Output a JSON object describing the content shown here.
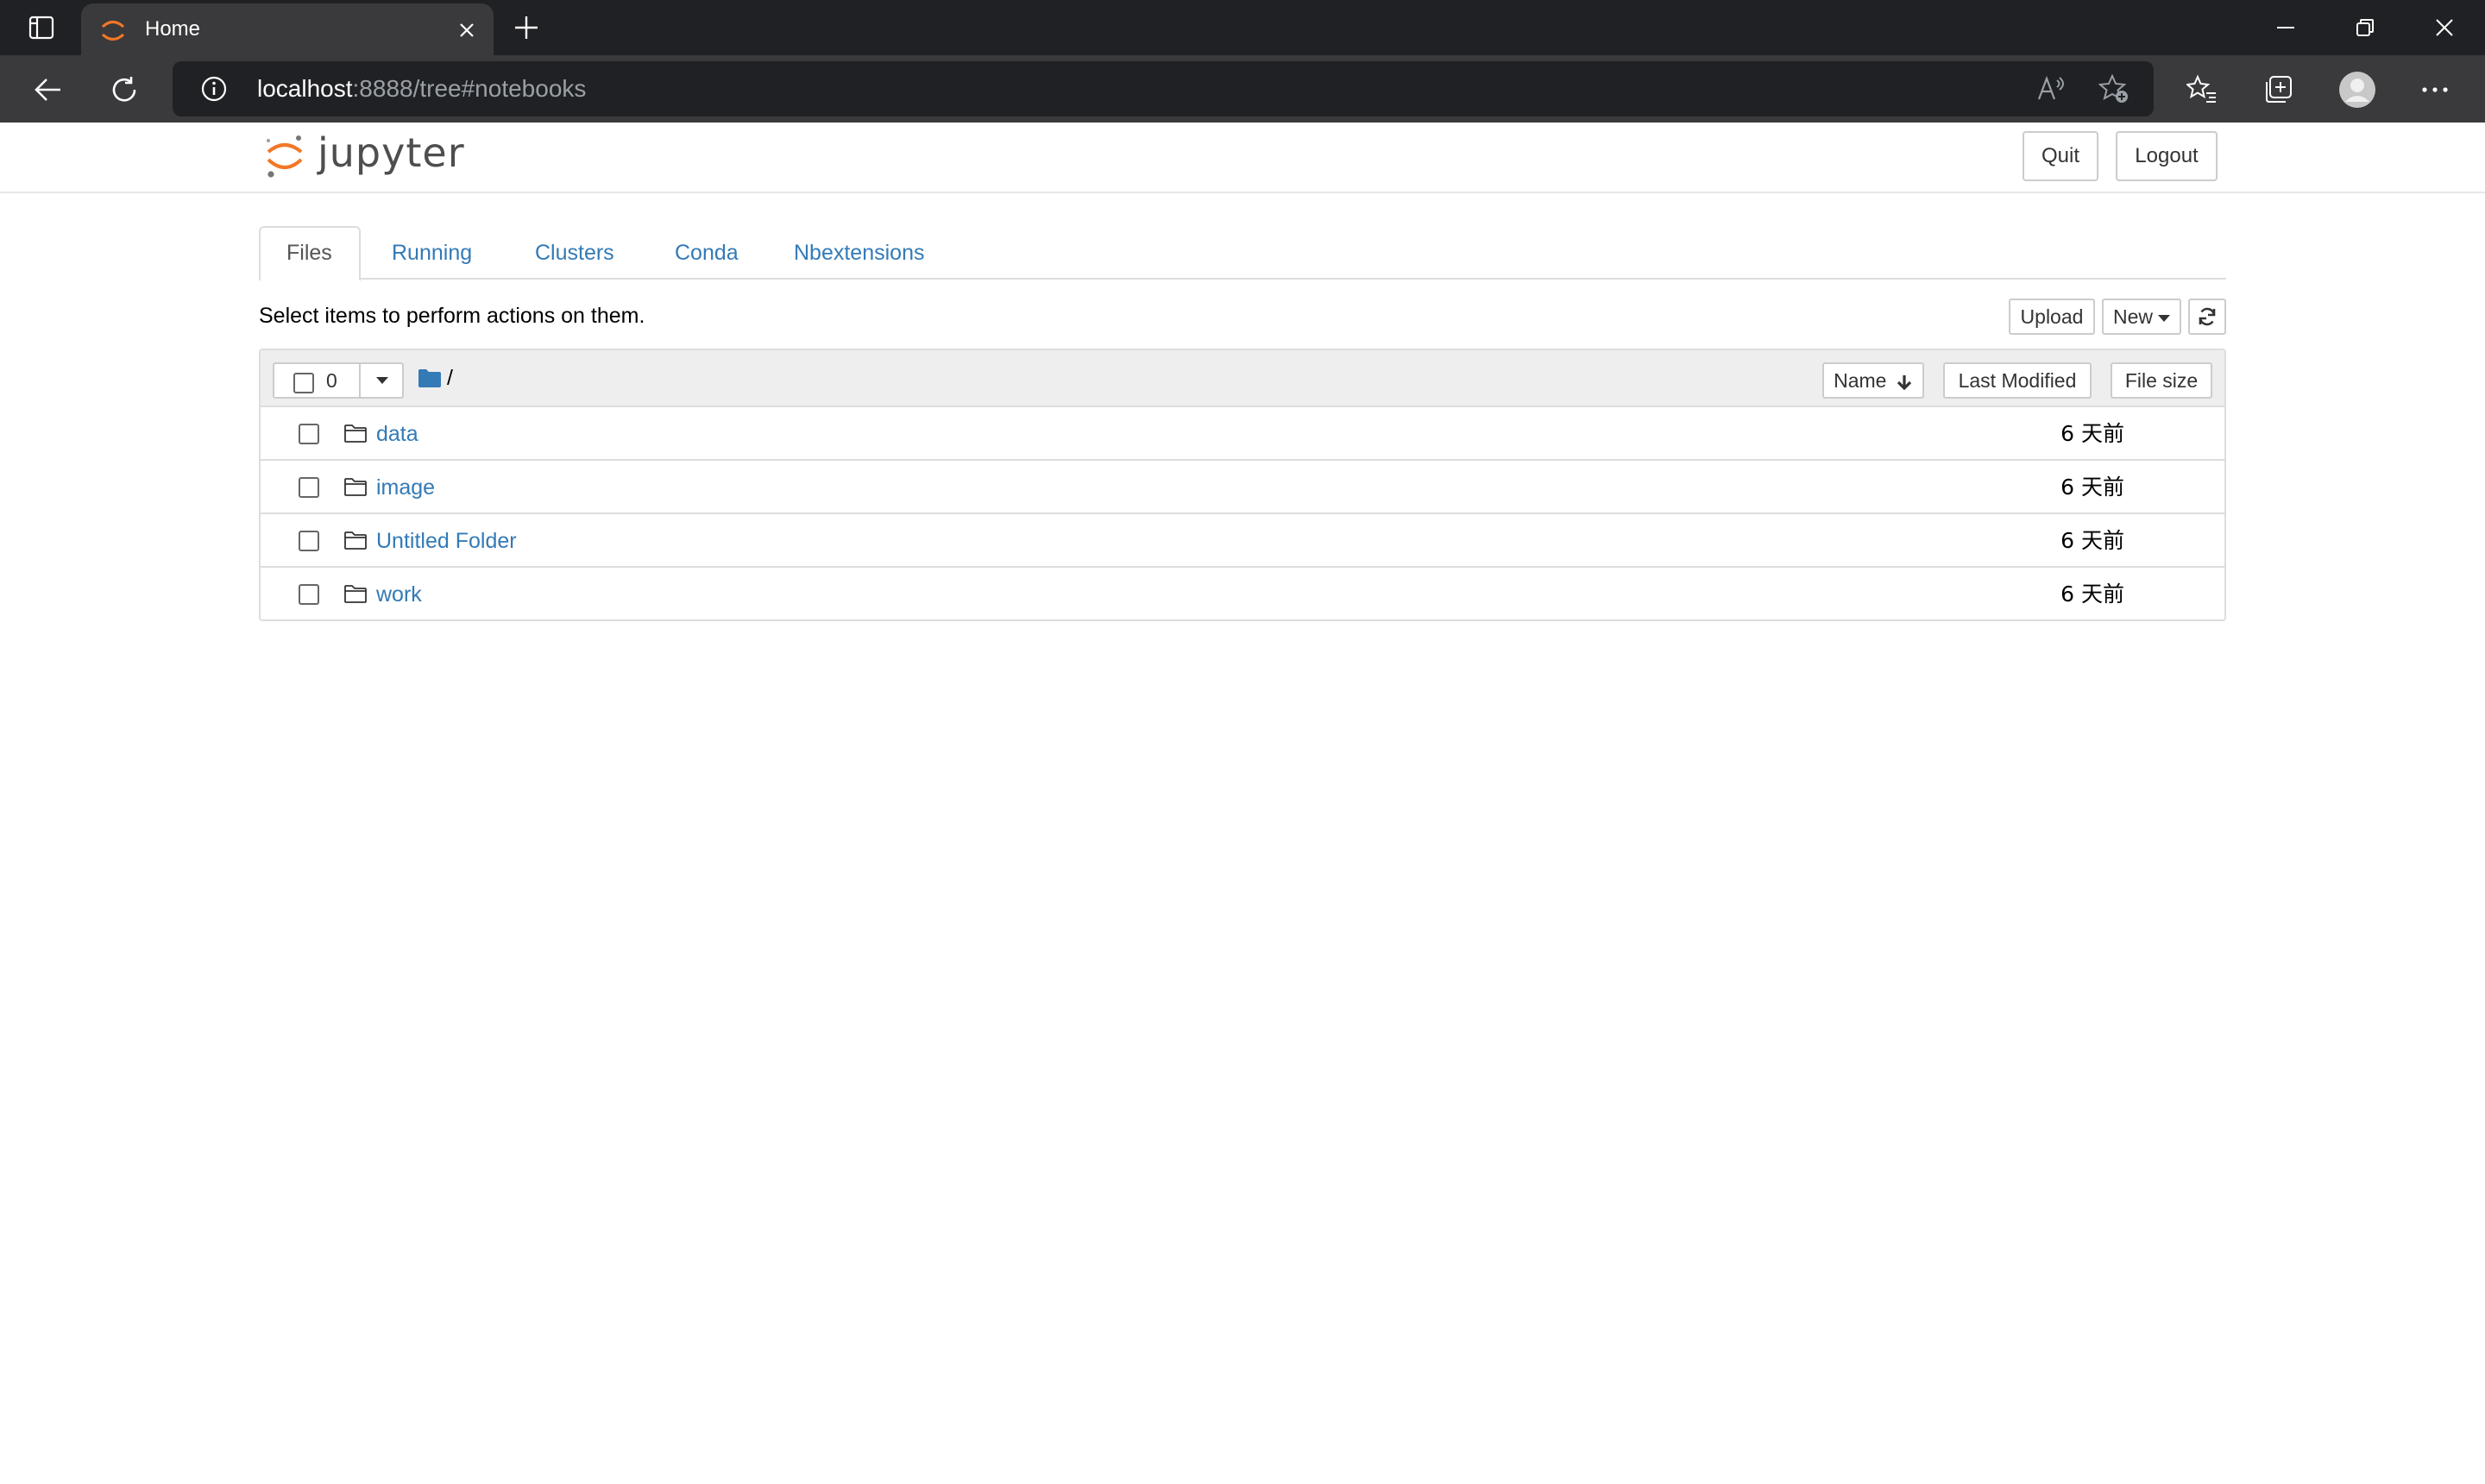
{
  "browser": {
    "tab_title": "Home",
    "url_host": "localhost",
    "url_rest": ":8888/tree#notebooks",
    "icons": {
      "tab_actions": "tab-actions-icon",
      "favicon": "jupyter-favicon",
      "close": "close-icon",
      "new_tab": "plus-icon",
      "back": "back-arrow-icon",
      "reload": "reload-icon",
      "info": "info-icon",
      "read_aloud": "read-aloud-icon",
      "add_favorite": "star-plus-icon",
      "favorites": "favorites-icon",
      "collections": "collections-icon",
      "profile": "profile-icon",
      "more": "more-icon"
    }
  },
  "header": {
    "logo_text": "jupyter",
    "quit_label": "Quit",
    "logout_label": "Logout"
  },
  "tabs": [
    {
      "label": "Files",
      "active": true
    },
    {
      "label": "Running",
      "active": false
    },
    {
      "label": "Clusters",
      "active": false
    },
    {
      "label": "Conda",
      "active": false
    },
    {
      "label": "Nbextensions",
      "active": false
    }
  ],
  "toolbar": {
    "hint": "Select items to perform actions on them.",
    "upload_label": "Upload",
    "new_label": "New"
  },
  "list": {
    "selected_count": "0",
    "breadcrumb_sep": "/",
    "sort_name_label": "Name",
    "sort_modified_label": "Last Modified",
    "sort_size_label": "File size",
    "items": [
      {
        "name": "data",
        "modified": "6 天前"
      },
      {
        "name": "image",
        "modified": "6 天前"
      },
      {
        "name": "Untitled Folder",
        "modified": "6 天前"
      },
      {
        "name": "work",
        "modified": "6 天前"
      }
    ]
  },
  "colors": {
    "chrome_dark": "#202124",
    "chrome_mid": "#3a3a3c",
    "link_blue": "#337ab7",
    "jupyter_orange": "#f37726"
  }
}
